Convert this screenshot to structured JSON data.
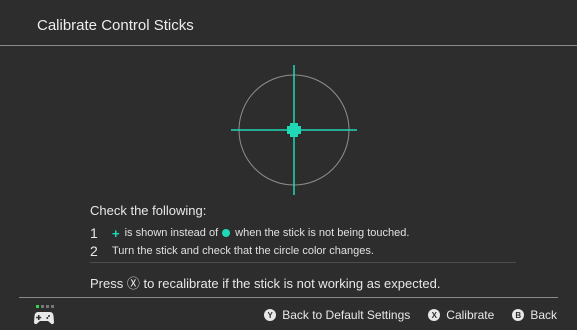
{
  "header": {
    "title": "Calibrate Control Sticks"
  },
  "colors": {
    "background": "#2d2d2d",
    "accent": "#20d8b6",
    "ring": "#8f8f8f",
    "text": "#e6e6e6"
  },
  "instructions": {
    "heading": "Check the following:",
    "steps": [
      {
        "number": "1",
        "before_plus": "",
        "middle": "is shown instead of",
        "after": "when the stick is not being touched."
      },
      {
        "number": "2",
        "text": "Turn the stick and check that the circle color changes."
      }
    ],
    "recalibrate_text": "Press Ⓧ to recalibrate if the stick is not working as expected."
  },
  "footer": {
    "controller_icon": "gamepad-icon",
    "buttons": [
      {
        "glyph": "Y",
        "label": "Back to Default Settings"
      },
      {
        "glyph": "X",
        "label": "Calibrate"
      },
      {
        "glyph": "B",
        "label": "Back"
      }
    ]
  }
}
